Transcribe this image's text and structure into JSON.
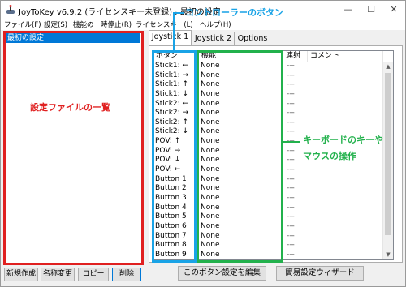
{
  "window": {
    "title": "JoyToKey v6.9.2 (ライセンスキー未登録) : 最初の設定",
    "minimize": "—",
    "maximize": "☐",
    "close": "✕"
  },
  "menu": [
    "ファイル(F)",
    "設定(S)",
    "機能の一時停止(R)",
    "ライセンスキー(L)",
    "ヘルプ(H)"
  ],
  "config_list": {
    "selected": "最初の設定"
  },
  "left_buttons": {
    "new": "新規作成",
    "rename": "名称変更",
    "copy": "コピー",
    "delete": "削除"
  },
  "tabs": [
    "Joystick 1",
    "Joystick 2",
    "Options"
  ],
  "table": {
    "headers": {
      "button": "ボタン",
      "function": "機能",
      "rapid": "連射",
      "comment": "コメント"
    },
    "rows": [
      {
        "button": "Stick1: ←",
        "function": "None",
        "rapid": "---"
      },
      {
        "button": "Stick1: →",
        "function": "None",
        "rapid": "---"
      },
      {
        "button": "Stick1: ↑",
        "function": "None",
        "rapid": "---"
      },
      {
        "button": "Stick1: ↓",
        "function": "None",
        "rapid": "---"
      },
      {
        "button": "Stick2: ←",
        "function": "None",
        "rapid": "---"
      },
      {
        "button": "Stick2: →",
        "function": "None",
        "rapid": "---"
      },
      {
        "button": "Stick2: ↑",
        "function": "None",
        "rapid": "---"
      },
      {
        "button": "Stick2: ↓",
        "function": "None",
        "rapid": "---"
      },
      {
        "button": "POV: ↑",
        "function": "None",
        "rapid": "---"
      },
      {
        "button": "POV: →",
        "function": "None",
        "rapid": "---"
      },
      {
        "button": "POV: ↓",
        "function": "None",
        "rapid": "---"
      },
      {
        "button": "POV: ←",
        "function": "None",
        "rapid": "---"
      },
      {
        "button": "Button 1",
        "function": "None",
        "rapid": "---"
      },
      {
        "button": "Button 2",
        "function": "None",
        "rapid": "---"
      },
      {
        "button": "Button 3",
        "function": "None",
        "rapid": "---"
      },
      {
        "button": "Button 4",
        "function": "None",
        "rapid": "---"
      },
      {
        "button": "Button 5",
        "function": "None",
        "rapid": "---"
      },
      {
        "button": "Button 6",
        "function": "None",
        "rapid": "---"
      },
      {
        "button": "Button 7",
        "function": "None",
        "rapid": "---"
      },
      {
        "button": "Button 8",
        "function": "None",
        "rapid": "---"
      },
      {
        "button": "Button 9",
        "function": "None",
        "rapid": "---"
      }
    ]
  },
  "bottom_buttons": {
    "edit": "このボタン設定を編集",
    "wizard": "簡易設定ウィザード"
  },
  "annotations": {
    "config_list_label": "設定ファイルの一覧",
    "controller_buttons_label": "コントローラーのボタン",
    "key_mouse_label_line1": "キーボードのキーや",
    "key_mouse_label_line2": "マウスの操作",
    "colors": {
      "red": "#e02020",
      "blue": "#19a3e6",
      "green": "#22b14c"
    }
  }
}
